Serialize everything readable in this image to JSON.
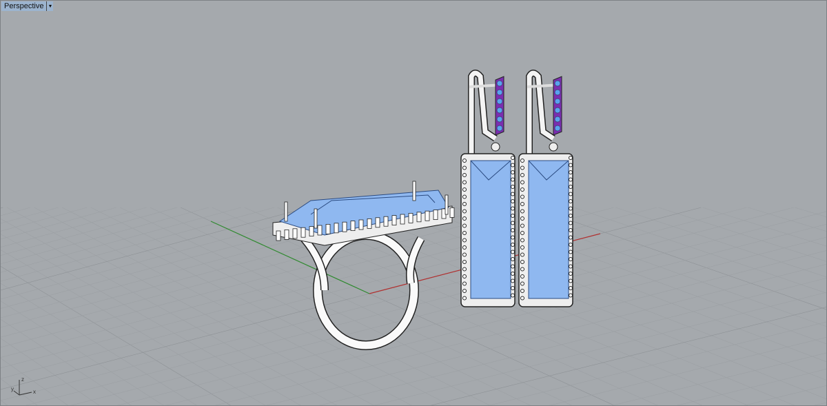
{
  "viewport": {
    "name": "Perspective",
    "menu_icon": "triangle-down-icon"
  },
  "axes_gizmo": {
    "x": "x",
    "y": "y",
    "z": "z"
  },
  "colors": {
    "background": "#a5a9ad",
    "grid": "#9a9ea2",
    "x_axis": "#b03030",
    "y_axis": "#2f8a2f",
    "gem": "#8fb8f0",
    "amethyst": "#7a2fb0"
  }
}
